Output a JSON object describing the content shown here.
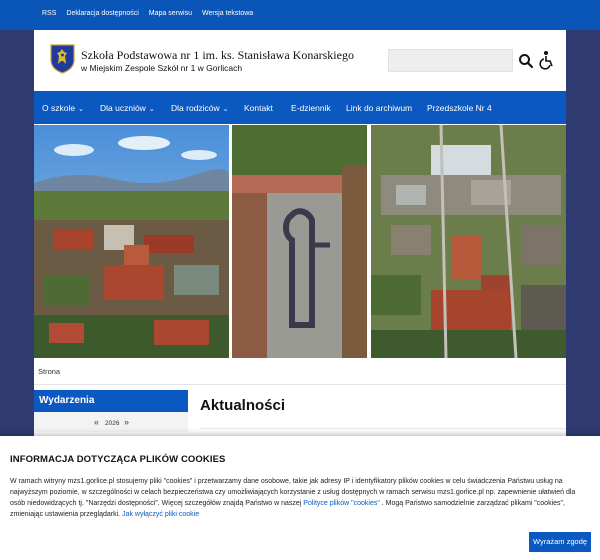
{
  "topbar": {
    "links": [
      "RSS",
      "Deklaracja dostępności",
      "Mapa serwisu",
      "Wersja tekstowa"
    ]
  },
  "header": {
    "title": "Szkoła Podstawowa nr 1 im. ks. Stanisława Konarskiego",
    "subtitle": "w Miejskim Zespole Szkół nr 1 w Gorlicach",
    "search_placeholder": ""
  },
  "icons": {
    "crest": "coat-of-arms-icon",
    "search": "search-icon",
    "accessibility": "accessibility-icon"
  },
  "nav": {
    "items": [
      {
        "label": "O szkole",
        "dropdown": true
      },
      {
        "label": "Dla uczniów",
        "dropdown": true
      },
      {
        "label": "Dla rodziców",
        "dropdown": true
      },
      {
        "label": "Kontakt",
        "dropdown": false
      },
      {
        "label": "E-dziennik",
        "dropdown": false
      },
      {
        "label": "Link do archiwum",
        "dropdown": false
      },
      {
        "label": "Przedszkole Nr 4",
        "dropdown": false
      }
    ],
    "chevron": "⌄"
  },
  "breadcrumb": "Strona",
  "sidebar": {
    "heading": "Wydarzenia",
    "year": "2026",
    "prev": "«",
    "next": "»"
  },
  "main": {
    "title": "Aktualności"
  },
  "cookie": {
    "title": "INFORMACJA DOTYCZĄCA PLIKÓW COOKIES",
    "text_1": "W ramach witryny mzs1.gorlice.pl stosujemy pliki \"cookies\" i przetwarzamy dane osobowe, takie jak adresy IP i identyfikatory plików cookies w celu świadczenia Państwu usług na najwyższym poziomie, w szczególności w celach bezpieczeństwa czy umożliwiających korzystanie z usług dostępnych w ramach serwisu mzs1.gorlice.pl np. zapewnienie ułatwień dla osób niedowidzących tj. \"Narzędzi dostępności\". Więcej szczegółów znajdą Państwo w naszej ",
    "policy_link": "Polityce plików \"cookies\"",
    "text_2": " . Mogą Państwo samodzielnie zarządzać plikami \"cookies\", zmieniając ustawienia przeglądarki. ",
    "disable_link": "Jak wyłączyć pliki cookie",
    "accept_label": "Wyrażam zgodę"
  },
  "colors": {
    "primary": "#0b59c0",
    "topbar": "#0a56b8",
    "side_background": "#2f3a70"
  }
}
